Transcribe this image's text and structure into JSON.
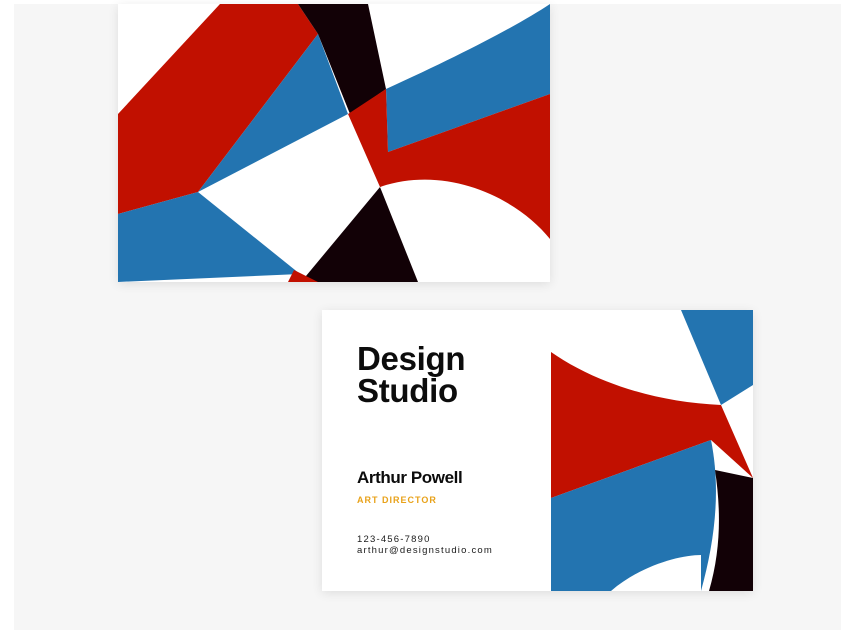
{
  "card_front": {
    "company_line1": "Design",
    "company_line2": "Studio",
    "name": "Arthur Powell",
    "title": "ART DIRECTOR",
    "phone": "123-456-7890",
    "email": "arthur@designstudio.com"
  },
  "colors": {
    "red": "#c11000",
    "blue": "#2374b0",
    "black": "#120106",
    "accent": "#e8a21a",
    "background": "#f6f6f6"
  }
}
